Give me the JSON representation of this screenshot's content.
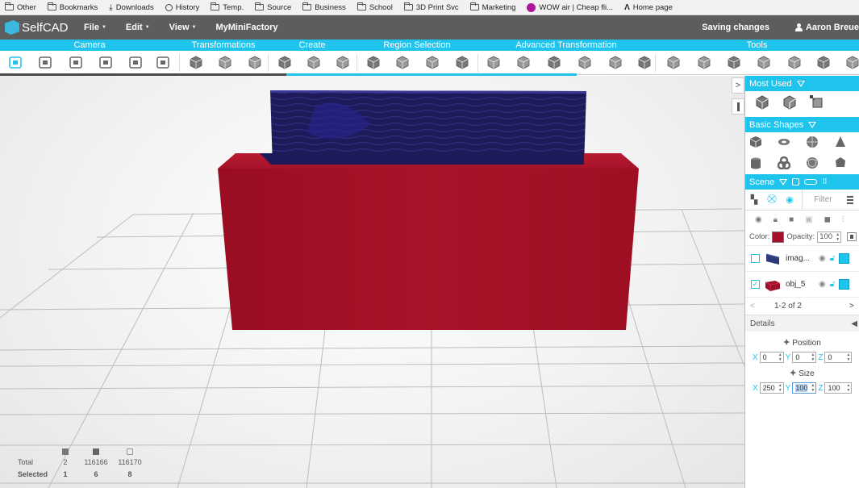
{
  "bookmarks": [
    {
      "label": "Other",
      "icon": "folder-icon"
    },
    {
      "label": "Bookmarks",
      "icon": "folder-icon"
    },
    {
      "label": "Downloads",
      "icon": "download-icon"
    },
    {
      "label": "History",
      "icon": "history-icon"
    },
    {
      "label": "Temp.",
      "icon": "folder-icon"
    },
    {
      "label": "Source",
      "icon": "folder-icon"
    },
    {
      "label": "Business",
      "icon": "folder-icon"
    },
    {
      "label": "School",
      "icon": "folder-icon"
    },
    {
      "label": "3D Print Svc",
      "icon": "folder-icon"
    },
    {
      "label": "Marketing",
      "icon": "folder-icon"
    },
    {
      "label": "WOW air | Cheap fli...",
      "icon": "wow-icon"
    },
    {
      "label": "Home page",
      "icon": "home-icon"
    }
  ],
  "header": {
    "logo": "SelfCAD",
    "menus": [
      "File",
      "Edit",
      "View"
    ],
    "link": "MyMiniFactory",
    "status": "Saving changes",
    "user": "Aaron Breue"
  },
  "categories": [
    "Camera",
    "Transformations",
    "Create",
    "Region Selection",
    "Advanced Transformation",
    "Tools"
  ],
  "stats": {
    "total_label": "Total",
    "selected_label": "Selected",
    "total": [
      "2",
      "116166",
      "116170"
    ],
    "selected": [
      "1",
      "6",
      "8"
    ]
  },
  "panel": {
    "most_used": "Most Used",
    "basic_shapes": "Basic Shapes",
    "scene": "Scene",
    "filter_placeholder": "Filter",
    "color_label": "Color:",
    "color_value": "#a5102a",
    "opacity_label": "Opacity:",
    "opacity_value": "100",
    "objects": [
      {
        "name": "imag...",
        "checked": false
      },
      {
        "name": "obj_5",
        "checked": true
      }
    ],
    "pager": "1-2 of 2",
    "details": "Details",
    "position": {
      "title": "Position",
      "x": "0",
      "y": "0",
      "z": "0"
    },
    "size": {
      "title": "Size",
      "x": "250",
      "y": "100",
      "z": "100"
    }
  },
  "colors": {
    "accent": "#1fc4ec",
    "header": "#5d5d5d",
    "object_red": "#a5102a",
    "object_navy": "#1e1a5c"
  }
}
